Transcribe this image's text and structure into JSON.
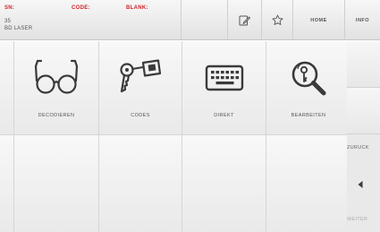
{
  "header": {
    "sn_label": "SN:",
    "code_label": "CODE:",
    "blank_label": "BLANK:",
    "sn_value": "35",
    "machine_name": "BD LASER",
    "home_label": "HOME",
    "info_label": "INFO",
    "icons": [
      "notepad-edit-icon",
      "star-icon"
    ]
  },
  "tiles": [
    {
      "label": "DECODIEREN",
      "icon": "glasses-icon"
    },
    {
      "label": "CODES",
      "icon": "key-tag-icon"
    },
    {
      "label": "DIREKT",
      "icon": "keyboard-icon"
    },
    {
      "label": "BEARBEITEN",
      "icon": "key-magnifier-icon"
    }
  ],
  "side_nav": {
    "back_label": "ZURÜCK",
    "next_label": "WEITER",
    "icon": "chevron-left-icon"
  },
  "colors": {
    "label_red": "#d2232a",
    "text_gray": "#555555"
  }
}
